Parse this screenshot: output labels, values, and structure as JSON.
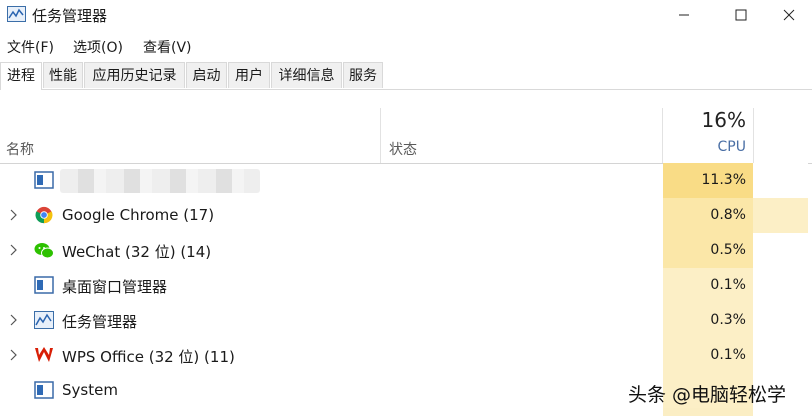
{
  "window": {
    "title": "任务管理器"
  },
  "menu": [
    "文件(F)",
    "选项(O)",
    "查看(V)"
  ],
  "tabs": [
    "进程",
    "性能",
    "应用历史记录",
    "启动",
    "用户",
    "详细信息",
    "服务"
  ],
  "active_tab": "进程",
  "columns": {
    "name": "名称",
    "status": "状态",
    "cpu_total": "16%",
    "cpu_label": "CPU"
  },
  "rows": [
    {
      "name": "",
      "cpu": "11.3%",
      "icon": "window-app-icon",
      "expandable": false
    },
    {
      "name": "Google Chrome (17)",
      "cpu": "0.8%",
      "icon": "chrome-icon",
      "expandable": true
    },
    {
      "name": "WeChat (32 位) (14)",
      "cpu": "0.5%",
      "icon": "wechat-icon",
      "expandable": true
    },
    {
      "name": "桌面窗口管理器",
      "cpu": "0.1%",
      "icon": "window-app-icon",
      "expandable": false
    },
    {
      "name": "任务管理器",
      "cpu": "0.3%",
      "icon": "task-manager-icon",
      "expandable": true
    },
    {
      "name": "WPS Office (32 位) (11)",
      "cpu": "0.1%",
      "icon": "wps-icon",
      "expandable": true
    },
    {
      "name": "System",
      "cpu": "",
      "icon": "window-app-icon",
      "expandable": false
    }
  ],
  "watermark": "头条 @电脑轻松学",
  "colors": {
    "cpu_high": "#f9dc86",
    "cpu_mid": "#fbe7a8",
    "cpu_low": "#fcefc6",
    "accent": "#4a6fa5"
  }
}
